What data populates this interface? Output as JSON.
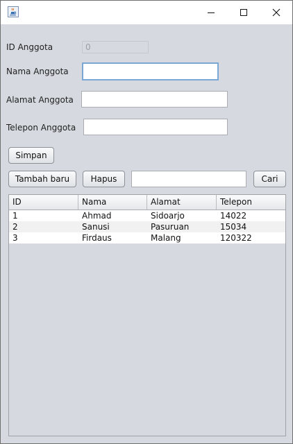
{
  "titlebar": {
    "app_icon": "java-icon",
    "minimize": "minimize-icon",
    "maximize": "maximize-icon",
    "close": "close-icon"
  },
  "form": {
    "id_label": "ID Anggota",
    "id_value": "0",
    "nama_label": "Nama Anggota",
    "nama_value": "",
    "alamat_label": "Alamat Anggota",
    "alamat_value": "",
    "telepon_label": "Telepon Anggota",
    "telepon_value": ""
  },
  "buttons": {
    "simpan": "Simpan",
    "tambah_baru": "Tambah baru",
    "hapus": "Hapus",
    "cari": "Cari"
  },
  "search": {
    "value": ""
  },
  "table": {
    "columns": [
      "ID",
      "Nama",
      "Alamat",
      "Telepon"
    ],
    "rows": [
      [
        "1",
        "Ahmad",
        "Sidoarjo",
        "14022"
      ],
      [
        "2",
        "Sanusi",
        "Pasuruan",
        "15034"
      ],
      [
        "3",
        "Firdaus",
        "Malang",
        "120322"
      ]
    ]
  }
}
